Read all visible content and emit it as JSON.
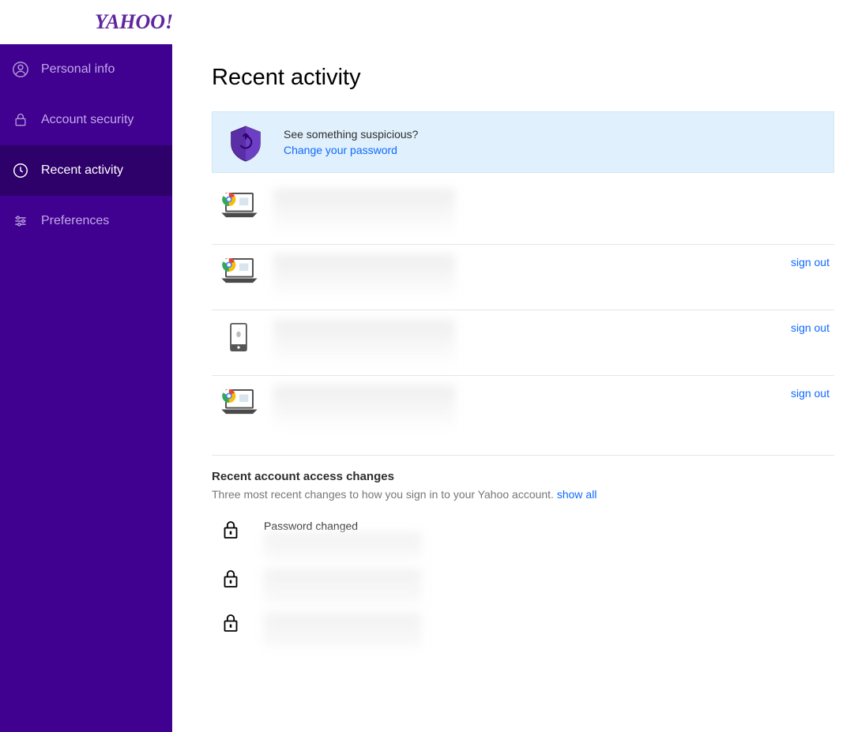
{
  "logo": "YAHOO!",
  "sidebar": {
    "items": [
      {
        "label": "Personal info"
      },
      {
        "label": "Account security"
      },
      {
        "label": "Recent activity"
      },
      {
        "label": "Preferences"
      }
    ]
  },
  "page": {
    "title": "Recent activity",
    "alert": {
      "question": "See something suspicious?",
      "action": "Change your password"
    },
    "signout": "sign out"
  },
  "changes_section": {
    "heading": "Recent account access changes",
    "subtext": "Three most recent changes to how you sign in to your Yahoo account.",
    "show_all": "show all",
    "item0_label": "Password changed"
  }
}
